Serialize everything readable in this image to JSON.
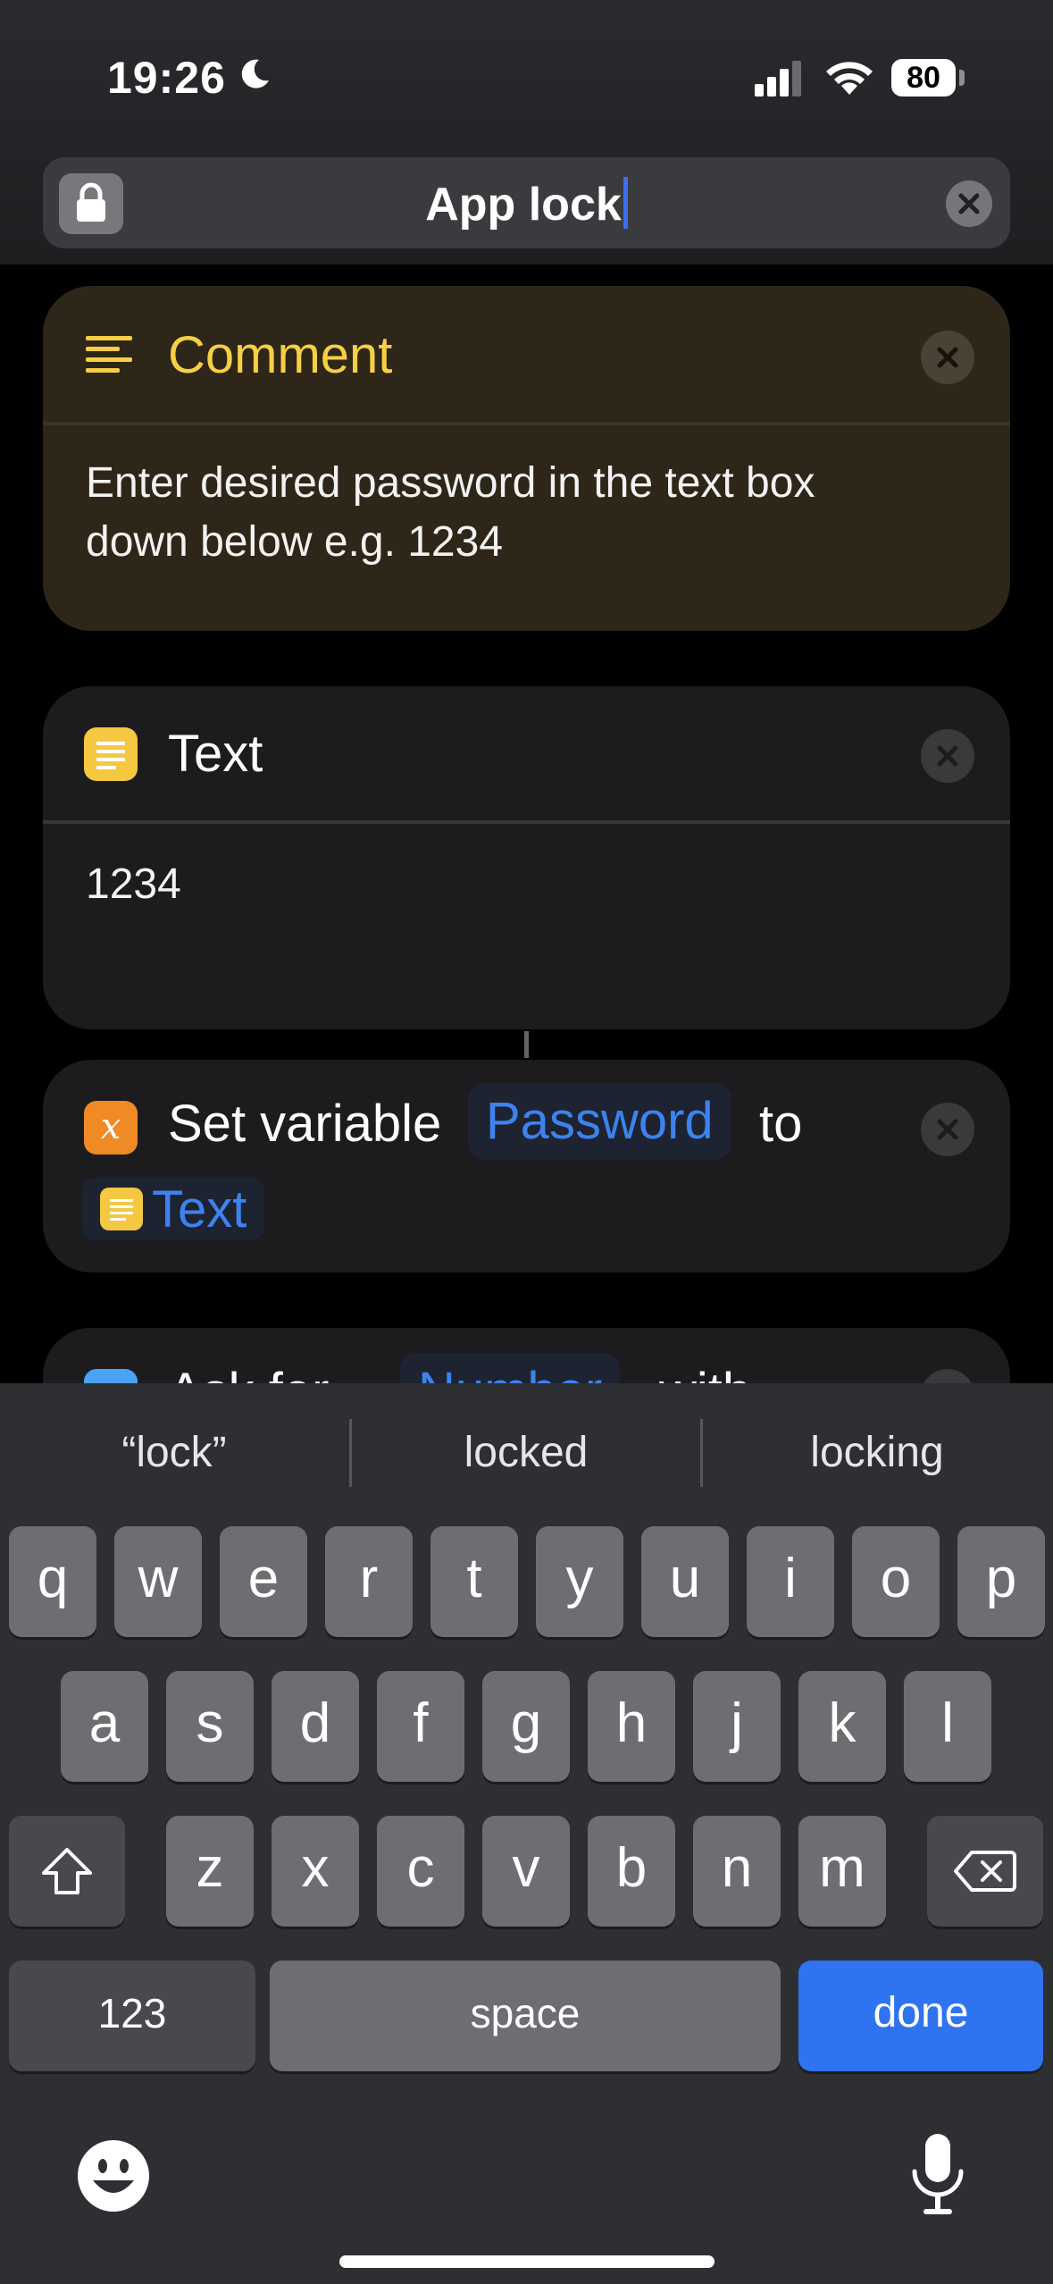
{
  "status_bar": {
    "time": "19:26",
    "battery": "80",
    "icons": [
      "moon-icon",
      "cellular-signal-icon",
      "wifi-icon",
      "battery-icon"
    ]
  },
  "header": {
    "title": "App lock",
    "icons": [
      "lock-icon",
      "clear-icon"
    ]
  },
  "actions": {
    "comment": {
      "title": "Comment",
      "body": "Enter desired password in the text box down below e.g. 1234",
      "accent": "#f7cf45"
    },
    "text": {
      "title": "Text",
      "value": "1234"
    },
    "set_variable": {
      "label": "Set variable",
      "variable": "Password",
      "to": "to",
      "input": "Text"
    },
    "ask_for": {
      "label": "Ask for",
      "type": "Number",
      "with": "with"
    }
  },
  "keyboard": {
    "suggestions": [
      "“lock”",
      "locked",
      "locking"
    ],
    "row1": [
      "q",
      "w",
      "e",
      "r",
      "t",
      "y",
      "u",
      "i",
      "o",
      "p"
    ],
    "row2": [
      "a",
      "s",
      "d",
      "f",
      "g",
      "h",
      "j",
      "k",
      "l"
    ],
    "row3": [
      "z",
      "x",
      "c",
      "v",
      "b",
      "n",
      "m"
    ],
    "numbers_key": "123",
    "space_key": "space",
    "done_key": "done",
    "accent": "#2f73f0",
    "icons": [
      "shift-icon",
      "delete-icon",
      "emoji-icon",
      "microphone-icon"
    ]
  }
}
